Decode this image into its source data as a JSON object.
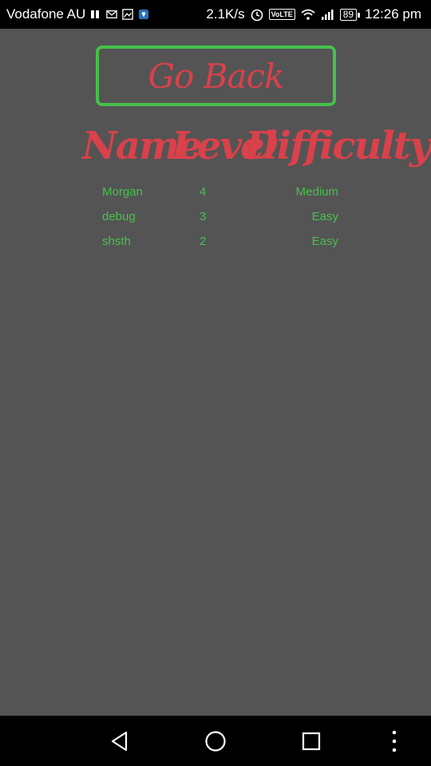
{
  "status_bar": {
    "carrier": "Vodafone AU",
    "network_speed": "2.1K/s",
    "volte_label": "VoLTE",
    "battery_level": "89",
    "time": "12:26 pm"
  },
  "go_back_label": "Go Back",
  "table": {
    "headers": [
      "Name",
      "Level",
      "Difficulty"
    ],
    "rows": [
      {
        "name": "Morgan",
        "level": "4",
        "difficulty": "Medium"
      },
      {
        "name": "debug",
        "level": "3",
        "difficulty": "Easy"
      },
      {
        "name": "shsth",
        "level": "2",
        "difficulty": "Easy"
      }
    ]
  },
  "colors": {
    "background": "#545454",
    "accent_red": "#d9414b",
    "accent_green": "#45c14a"
  },
  "icons": [
    "sim-icon",
    "mail-icon",
    "photo-icon",
    "shield-app-icon",
    "alarm-icon",
    "volte-icon",
    "wifi-icon",
    "signal-icon",
    "battery-icon",
    "nav-back-icon",
    "nav-home-icon",
    "nav-recents-icon",
    "nav-menu-icon"
  ]
}
